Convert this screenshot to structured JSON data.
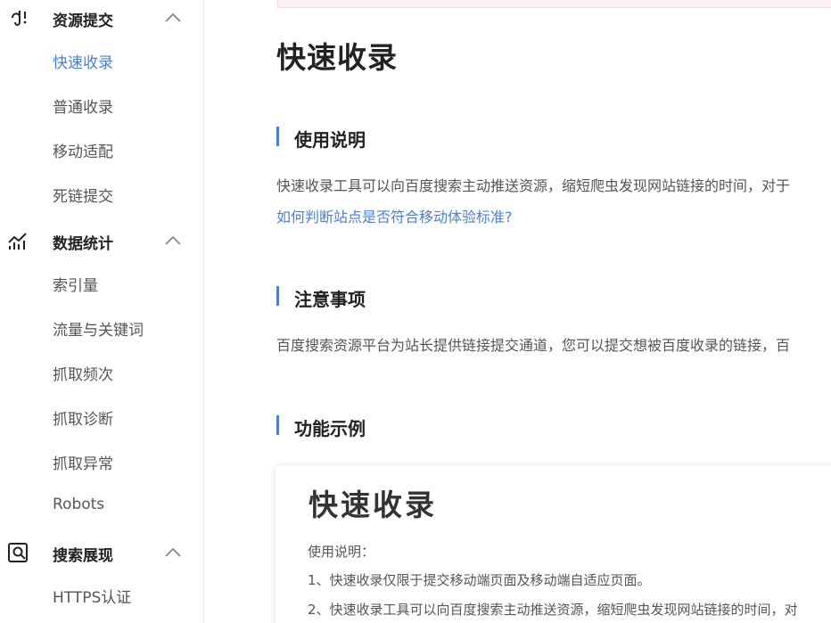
{
  "sidebar": {
    "groups": [
      {
        "title": "资源提交",
        "icon": "resource-submit-icon",
        "items": [
          "快速收录",
          "普通收录",
          "移动适配",
          "死链提交"
        ],
        "active_item": "快速收录"
      },
      {
        "title": "数据统计",
        "icon": "data-stats-icon",
        "items": [
          "索引量",
          "流量与关键词",
          "抓取频次",
          "抓取诊断",
          "抓取异常",
          "Robots"
        ]
      },
      {
        "title": "搜索展现",
        "icon": "search-display-icon",
        "items": [
          "HTTPS认证"
        ]
      }
    ]
  },
  "main": {
    "title": "快速收录",
    "sections": [
      {
        "title": "使用说明",
        "text": "快速收录工具可以向百度搜索主动推送资源，缩短爬虫发现网站链接的时间，对于",
        "link": "如何判断站点是否符合移动体验标准?"
      },
      {
        "title": "注意事项",
        "text": "百度搜索资源平台为站长提供链接提交通道，您可以提交想被百度收录的链接，百"
      },
      {
        "title": "功能示例"
      }
    ],
    "example": {
      "title": "快速收录",
      "lines": [
        "使用说明：",
        "1、快速收录仅限于提交移动端页面及移动端自适应页面。",
        "2、快速收录工具可以向百度搜索主动推送资源，缩短爬虫发现网站链接的时间，对"
      ]
    }
  },
  "colors": {
    "accent": "#4a7fd8",
    "alert_bg": "#fdf1f1"
  }
}
